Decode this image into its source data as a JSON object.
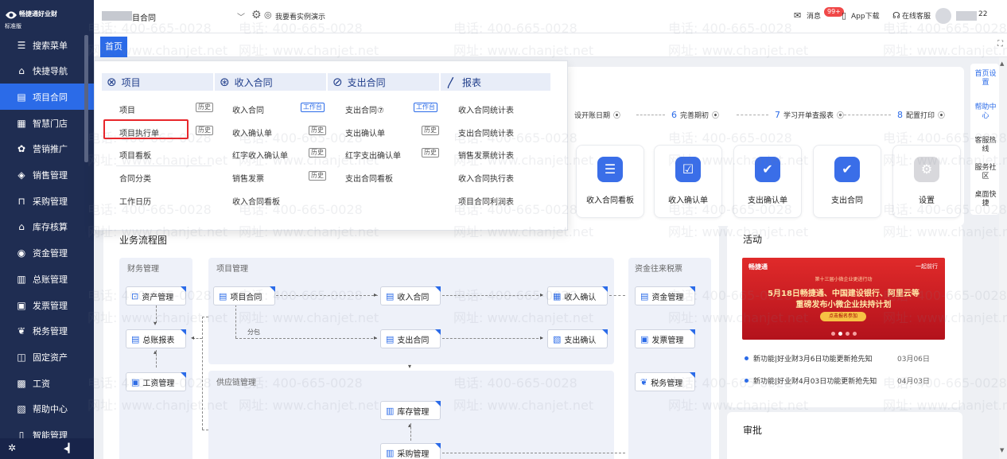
{
  "sidebar": {
    "logo_name": "畅捷通好业财",
    "edition": "标准版",
    "items": [
      {
        "label": "搜索菜单",
        "icon": "search-icon",
        "glyph": "☰"
      },
      {
        "label": "快捷导航",
        "icon": "home-icon",
        "glyph": "⌂"
      },
      {
        "label": "项目合同",
        "icon": "contract-icon",
        "glyph": "▤"
      },
      {
        "label": "智慧门店",
        "icon": "store-icon",
        "glyph": "▦"
      },
      {
        "label": "营销推广",
        "icon": "gift-icon",
        "glyph": "✿"
      },
      {
        "label": "销售管理",
        "icon": "sales-icon",
        "glyph": "◈"
      },
      {
        "label": "采购管理",
        "icon": "cart-icon",
        "glyph": "⊓"
      },
      {
        "label": "库存核算",
        "icon": "warehouse-icon",
        "glyph": "⌂"
      },
      {
        "label": "资金管理",
        "icon": "money-icon",
        "glyph": "◉"
      },
      {
        "label": "总账管理",
        "icon": "ledger-icon",
        "glyph": "▥"
      },
      {
        "label": "发票管理",
        "icon": "invoice-icon",
        "glyph": "▣"
      },
      {
        "label": "税务管理",
        "icon": "tax-icon",
        "glyph": "❦"
      },
      {
        "label": "固定资产",
        "icon": "asset-icon",
        "glyph": "◫"
      },
      {
        "label": "工资",
        "icon": "salary-icon",
        "glyph": "▩"
      },
      {
        "label": "帮助中心",
        "icon": "help-icon",
        "glyph": "▧"
      },
      {
        "label": "智能管理",
        "icon": "smart-icon",
        "glyph": "▯"
      }
    ],
    "active_index": 2
  },
  "topbar": {
    "account_name": "目合同",
    "demo_label": "我要看实例演示",
    "message_label": "消息",
    "message_badge": "99+",
    "app_label": "App下载",
    "service_label": "在线客服",
    "user_suffix": "22"
  },
  "tabs": {
    "home": "首页"
  },
  "right_rail": [
    "首页设置",
    "帮助中心",
    "客服热线",
    "服务社区",
    "桌面快捷"
  ],
  "steps": [
    {
      "num": "",
      "label": "设开账日期"
    },
    {
      "num": "6",
      "label": "完善期初"
    },
    {
      "num": "7",
      "label": "学习开单查报表"
    },
    {
      "num": "8",
      "label": "配置打印"
    }
  ],
  "quick_cards": [
    {
      "label": "收入合同看板",
      "icon": "list-icon",
      "glyph": "☰"
    },
    {
      "label": "收入确认单",
      "icon": "check-icon",
      "glyph": "☑"
    },
    {
      "label": "支出确认单",
      "icon": "doc-check-icon",
      "glyph": "✔"
    },
    {
      "label": "支出合同",
      "icon": "contract-check-icon",
      "glyph": "✔"
    },
    {
      "label": "设置",
      "icon": "settings-icon",
      "glyph": "⚙"
    }
  ],
  "flow": {
    "title": "业务流程图",
    "lanes": {
      "finance": "财务管理",
      "project": "项目管理",
      "supply": "供应链管理",
      "funds": "资金往来税票"
    },
    "nodes": {
      "asset": "资产管理",
      "ledger": "总账报表",
      "salary": "工资管理",
      "project": "项目合同",
      "income_contract": "收入合同",
      "income_confirm": "收入确认",
      "expense_contract": "支出合同",
      "expense_confirm": "支出确认",
      "inventory": "库存管理",
      "purchase": "采购管理",
      "funds": "资金管理",
      "invoice": "发票管理",
      "tax": "税务管理"
    },
    "subcontract": "分包"
  },
  "activity": {
    "title": "活动",
    "banner": {
      "logo": "畅捷通",
      "logo_right": "一起前行",
      "sub": "第十三届小微企业更进行动",
      "line1": "5月18日畅捷通、中国建设银行、阿里云等",
      "line2": "重磅发布小微企业扶持计划",
      "button": "点击报名参加"
    },
    "news": [
      {
        "text": "新功能|好业财3月6日功能更新抢先知",
        "date": "03月06日"
      },
      {
        "text": "新功能|好业财4月03日功能更新抢先知",
        "date": "04月03日"
      }
    ]
  },
  "approval": {
    "title": "审批"
  },
  "menu": {
    "columns": [
      {
        "title": "项目",
        "icon": "project-icon",
        "items": [
          {
            "label": "项目",
            "tag": "历史"
          },
          {
            "label": "项目执行单",
            "tag": "历史"
          },
          {
            "label": "项目看板",
            "tag": ""
          },
          {
            "label": "合同分类",
            "tag": ""
          },
          {
            "label": "工作日历",
            "tag": ""
          }
        ]
      },
      {
        "title": "收入合同",
        "icon": "income-contract-icon",
        "items": [
          {
            "label": "收入合同",
            "tag": "工作台"
          },
          {
            "label": "收入确认单",
            "tag": "历史"
          },
          {
            "label": "红字收入确认单",
            "tag": "历史"
          },
          {
            "label": "销售发票",
            "tag": "历史"
          },
          {
            "label": "收入合同看板",
            "tag": ""
          }
        ]
      },
      {
        "title": "支出合同",
        "icon": "expense-contract-icon",
        "items": [
          {
            "label": "支出合同⑦",
            "tag": "工作台"
          },
          {
            "label": "支出确认单",
            "tag": "历史"
          },
          {
            "label": "红字支出确认单",
            "tag": "历史"
          },
          {
            "label": "支出合同看板",
            "tag": ""
          }
        ]
      },
      {
        "title": "报表",
        "icon": "report-icon",
        "items": [
          {
            "label": "收入合同统计表",
            "tag": ""
          },
          {
            "label": "支出合同统计表",
            "tag": ""
          },
          {
            "label": "销售发票统计表",
            "tag": ""
          },
          {
            "label": "收入合同执行表",
            "tag": ""
          },
          {
            "label": "项目合同利润表",
            "tag": ""
          }
        ]
      }
    ]
  },
  "watermark": {
    "phone": "电话: 400-665-0028",
    "site": "网址: www.chanjet.net"
  }
}
